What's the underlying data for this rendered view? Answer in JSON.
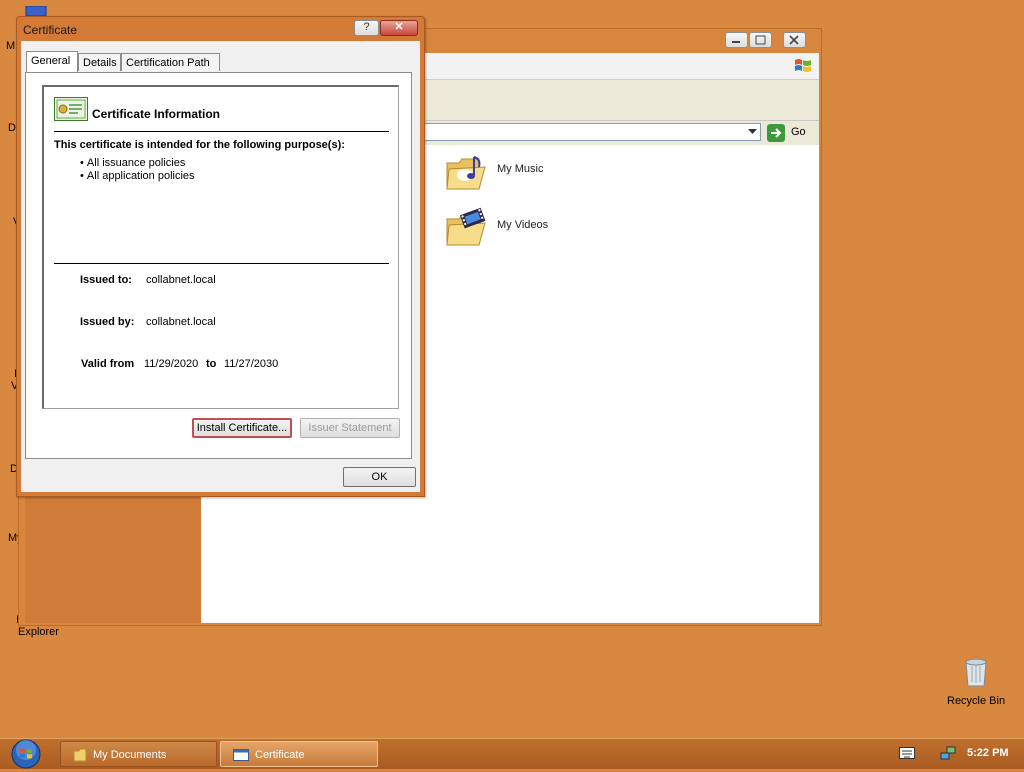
{
  "desktop": {
    "partial_labels": [
      "M",
      "D",
      "V",
      "I",
      "V",
      "D",
      "My",
      "I"
    ],
    "explorer_label": "Explorer",
    "recycle_bin_label": "Recycle Bin"
  },
  "explorer_window": {
    "go_label": "Go",
    "folders": [
      {
        "name": "My Music",
        "icon": "music-folder-icon"
      },
      {
        "name": "My Videos",
        "icon": "video-folder-icon"
      }
    ]
  },
  "dialog": {
    "title": "Certificate",
    "help_glyph": "?",
    "close_glyph": "✕",
    "tabs": [
      "General",
      "Details",
      "Certification Path"
    ],
    "info_heading": "Certificate Information",
    "purpose_heading": "This certificate is intended for the following purpose(s):",
    "purposes": [
      "All issuance policies",
      "All application policies"
    ],
    "issued_to_label": "Issued to:",
    "issued_to_value": "collabnet.local",
    "issued_by_label": "Issued by:",
    "issued_by_value": "collabnet.local",
    "valid_from_label": "Valid from",
    "valid_from_value": "11/29/2020",
    "valid_to_label": "to",
    "valid_to_value": "11/27/2030",
    "install_button": "Install Certificate...",
    "issuer_button": "Issuer Statement",
    "ok_button": "OK"
  },
  "taskbar": {
    "tasks": [
      "My Documents",
      "Certificate"
    ],
    "clock": "5:22 PM"
  }
}
